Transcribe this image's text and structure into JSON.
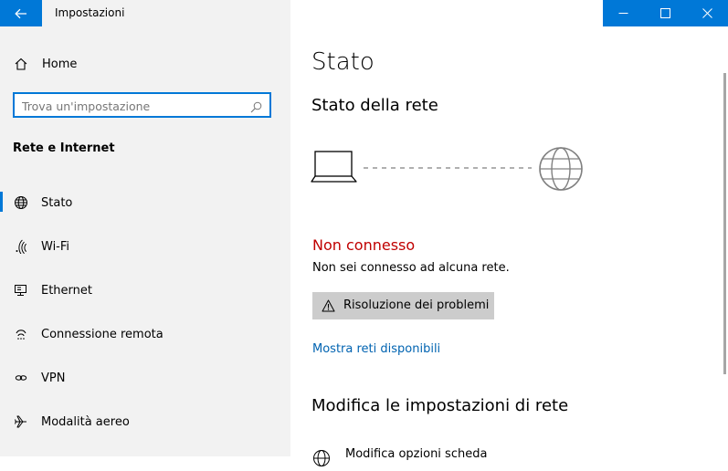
{
  "window": {
    "app_title": "Impostazioni",
    "accent_color": "#0078d7"
  },
  "sidebar": {
    "home_label": "Home",
    "search_placeholder": "Trova un'impostazione",
    "section_title": "Rete e Internet",
    "items": [
      {
        "label": "Stato",
        "icon": "globe-icon",
        "active": true
      },
      {
        "label": "Wi-Fi",
        "icon": "wifi-icon"
      },
      {
        "label": "Ethernet",
        "icon": "ethernet-icon"
      },
      {
        "label": "Connessione remota",
        "icon": "dialup-icon"
      },
      {
        "label": "VPN",
        "icon": "vpn-icon"
      },
      {
        "label": "Modalità aereo",
        "icon": "airplane-icon"
      }
    ]
  },
  "main": {
    "title": "Stato",
    "network_status_title": "Stato della rete",
    "status_title": "Non connesso",
    "status_color": "#c00000",
    "status_desc": "Non sei connesso ad alcuna rete.",
    "troubleshoot_label": "Risoluzione dei problemi",
    "show_networks_link": "Mostra reti disponibili",
    "change_settings_title": "Modifica le impostazioni di rete",
    "option_1_label": "Modifica opzioni scheda"
  }
}
